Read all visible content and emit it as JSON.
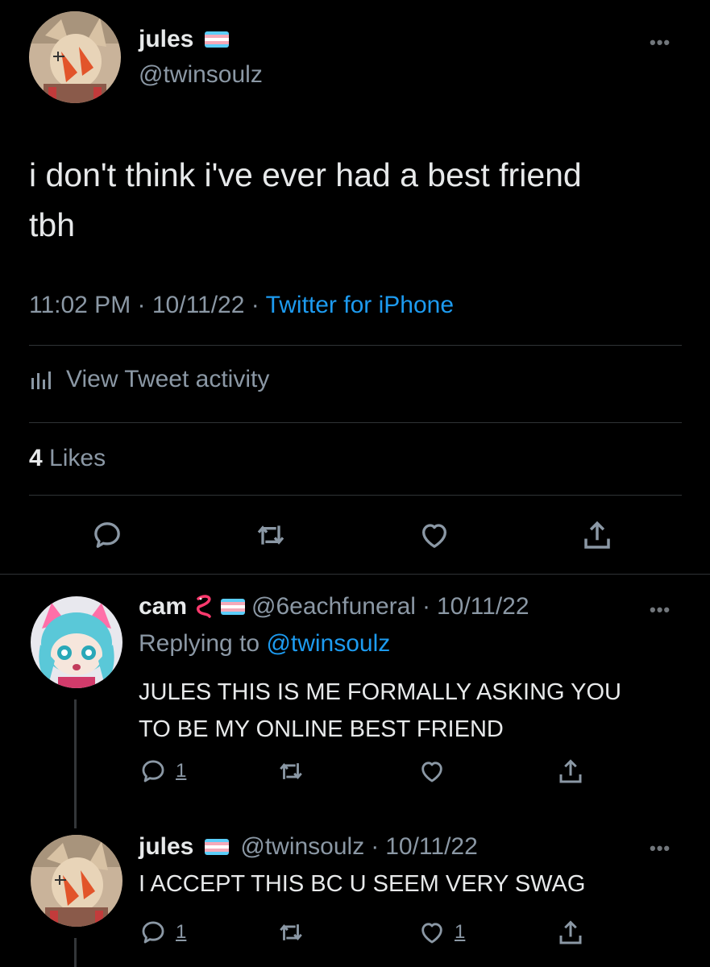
{
  "main_tweet": {
    "name": "jules",
    "handle": "@twinsoulz",
    "text_line1": "i don't think i've ever had a best friend",
    "text_line2": "tbh",
    "time": "11:02 PM",
    "date": "10/11/22",
    "source": "Twitter for iPhone",
    "activity_label": "View Tweet activity",
    "likes_count": "4",
    "likes_label": "Likes"
  },
  "reply1": {
    "name": "cam",
    "handle": "@6eachfuneral",
    "date": "10/11/22",
    "replying_prefix": "Replying to",
    "replying_to": "@twinsoulz",
    "text_line1": "JULES THIS IS ME FORMALLY ASKING YOU",
    "text_line2": "TO BE MY ONLINE BEST FRIEND",
    "reply_count": "1"
  },
  "reply2": {
    "name": "jules",
    "handle": "@twinsoulz",
    "date": "10/11/22",
    "text": "I ACCEPT THIS BC U SEEM VERY SWAG",
    "reply_count": "1",
    "like_count": "1"
  },
  "separator": "·",
  "icons": {
    "more": "more-dots-icon",
    "reply": "reply-icon",
    "retweet": "retweet-icon",
    "like": "heart-icon",
    "share": "share-icon",
    "activity": "bar-chart-icon",
    "flag": "trans-flag-icon",
    "snake": "snake-emoji-icon"
  },
  "colors": {
    "background": "#000000",
    "text": "#e7e9ea",
    "muted": "#8b98a5",
    "link": "#1d9bf0",
    "divider": "#2f3336"
  }
}
